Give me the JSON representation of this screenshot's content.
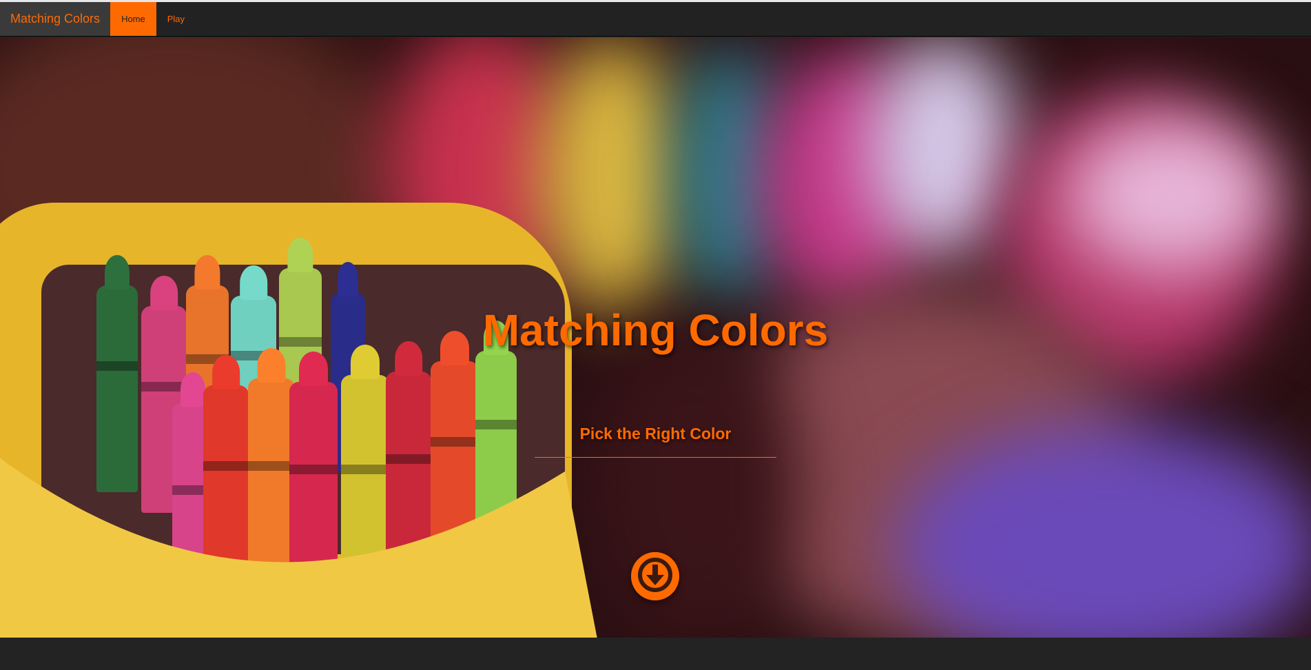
{
  "navbar": {
    "brand": "Matching Colors",
    "items": [
      {
        "label": "Home",
        "active": true
      },
      {
        "label": "Play",
        "active": false
      }
    ]
  },
  "hero": {
    "title": "Matching Colors",
    "subtitle": "Pick the Right Color",
    "scroll_icon": "arrow-circle-down-icon"
  },
  "colors": {
    "accent": "#ff6a00",
    "navbar_bg": "#222222",
    "footer_bg": "#232323"
  }
}
